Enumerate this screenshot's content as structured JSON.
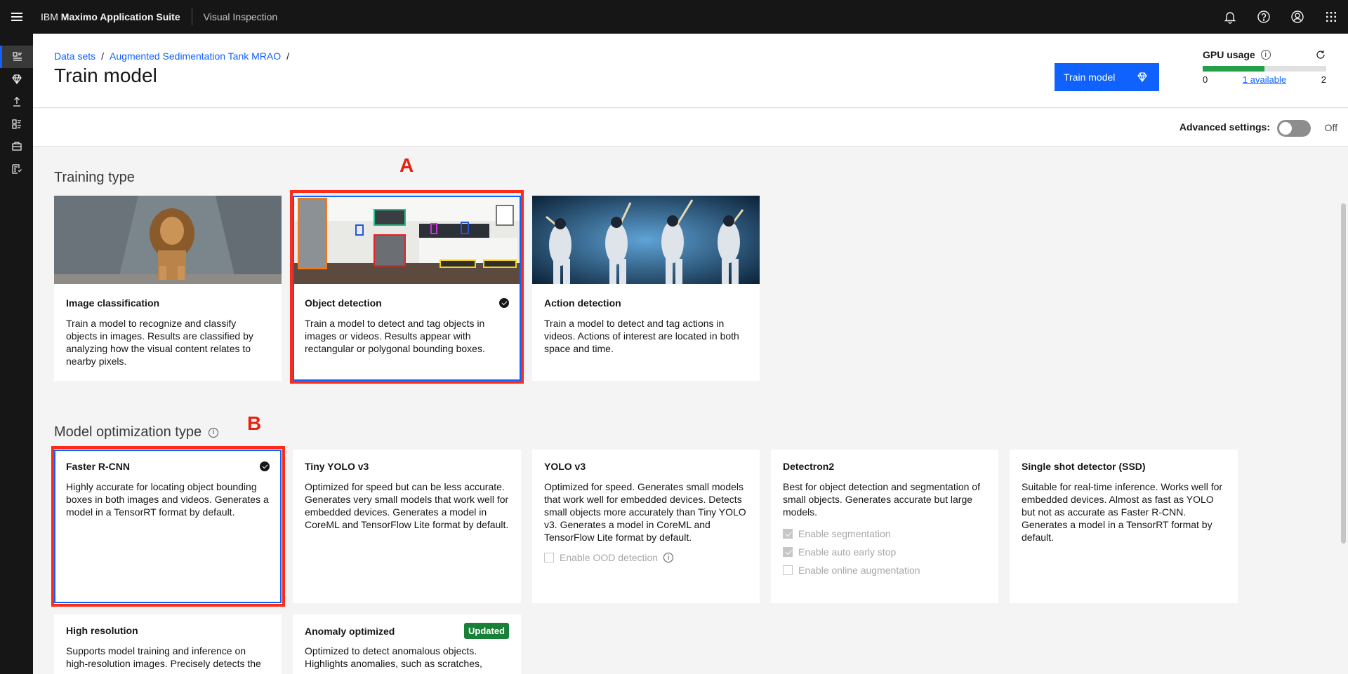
{
  "header": {
    "brand_prefix": "IBM",
    "brand_name": "Maximo Application Suite",
    "product": "Visual Inspection",
    "icons": [
      "notification-icon",
      "help-icon",
      "user-icon",
      "app-switcher-icon"
    ]
  },
  "siderail": {
    "icons": [
      "datasets-icon",
      "models-icon",
      "deploy-icon",
      "projects-icon",
      "edge-icon",
      "reports-icon"
    ]
  },
  "breadcrumb": [
    "Data sets",
    "Augmented Sedimentation Tank MRAO"
  ],
  "page": {
    "title": "Train model",
    "train_button": "Train model"
  },
  "gpu": {
    "title": "GPU usage",
    "min": "0",
    "max": "2",
    "available": "1 available",
    "used_fraction": 0.5
  },
  "advanced": {
    "label": "Advanced settings:",
    "state": "Off"
  },
  "training_type": {
    "title": "Training type",
    "annotation": "A",
    "cards": [
      {
        "title": "Image classification",
        "desc": "Train a model to recognize and classify objects in images. Results are classified by analyzing how the visual content relates to nearby pixels.",
        "selected": false
      },
      {
        "title": "Object detection",
        "desc": "Train a model to detect and tag objects in images or videos. Results appear with rectangular or polygonal bounding boxes.",
        "selected": true
      },
      {
        "title": "Action detection",
        "desc": "Train a model to detect and tag actions in videos. Actions of interest are located in both space and time.",
        "selected": false
      }
    ]
  },
  "model_optimization": {
    "title": "Model optimization type",
    "annotation": "B",
    "cards": [
      {
        "title": "Faster R-CNN",
        "desc": "Highly accurate for locating object bounding boxes in both images and videos. Generates a model in a TensorRT format by default.",
        "selected": true
      },
      {
        "title": "Tiny YOLO v3",
        "desc": "Optimized for speed but can be less accurate. Generates very small models that work well for embedded devices. Generates a model in CoreML and TensorFlow Lite format by default."
      },
      {
        "title": "YOLO v3",
        "desc": "Optimized for speed. Generates small models that work well for embedded devices. Detects small objects more accurately than Tiny YOLO v3. Generates a model in CoreML and TensorFlow Lite format by default.",
        "option": "Enable OOD detection"
      },
      {
        "title": "Detectron2",
        "desc": "Best for object detection and segmentation of small objects. Generates accurate but large models.",
        "options": [
          "Enable segmentation",
          "Enable auto early stop",
          "Enable online augmentation"
        ]
      },
      {
        "title": "Single shot detector (SSD)",
        "desc": "Suitable for real-time inference. Works well for embedded devices. Almost as fast as YOLO but not as accurate as Faster R-CNN. Generates a model in a TensorRT format by default."
      },
      {
        "title": "High resolution",
        "desc": "Supports model training and inference on high-resolution images. Precisely detects the"
      },
      {
        "title": "Anomaly optimized",
        "badge": "Updated",
        "desc": "Optimized to detect anomalous objects. Highlights anomalies, such as scratches,"
      }
    ]
  }
}
